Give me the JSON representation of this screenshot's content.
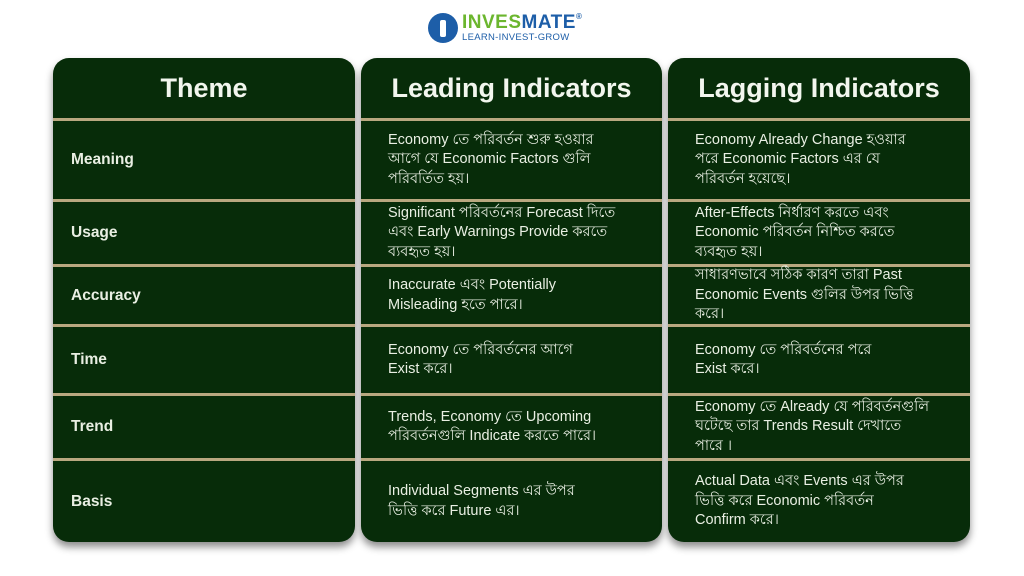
{
  "brand": {
    "name_part1": "INVES",
    "name_part2": "MATE",
    "registered": "®",
    "tagline": "LEARN-INVEST-GROW",
    "colors": {
      "green": "#6bb62e",
      "blue": "#1d5ea8"
    }
  },
  "table": {
    "headers": [
      "Theme",
      "Leading Indicators",
      "Lagging Indicators"
    ],
    "rows": [
      {
        "theme": "Meaning",
        "leading": "Economy তে পরিবর্তন শুরু হওয়ার\nআগে যে Economic Factors গুলি\nপরিবর্তিত হয়।",
        "lagging": "Economy Already Change হওয়ার\nপরে Economic Factors এর যে\nপরিবর্তন হয়েছে।"
      },
      {
        "theme": "Usage",
        "leading": "Significant পরিবর্তনের Forecast দিতে\nএবং Early Warnings Provide করতে\nব্যবহৃত হয়।",
        "lagging": "After-Effects নির্ধারণ করতে এবং\nEconomic পরিবর্তন নিশ্চিত করতে\nব্যবহৃত হয়।"
      },
      {
        "theme": "Accuracy",
        "leading": "Inaccurate এবং Potentially\nMisleading হতে পারে।",
        "lagging": "সাধারণভাবে সঠিক কারণ তারা Past\nEconomic Events গুলির উপর ভিত্তি\nকরে।"
      },
      {
        "theme": "Time",
        "leading": "Economy তে পরিবর্তনের আগে\nExist করে।",
        "lagging": "Economy তে পরিবর্তনের পরে\nExist করে।"
      },
      {
        "theme": "Trend",
        "leading": "Trends, Economy তে Upcoming\nপরিবর্তনগুলি Indicate করতে পারে।",
        "lagging": "Economy তে Already যে পরিবর্তনগুলি\nঘটেছে তার Trends Result দেখাতে\nপারে ।"
      },
      {
        "theme": "Basis",
        "leading": "Individual Segments এর উপর\nভিত্তি করে Future এর।",
        "lagging": "Actual Data এবং Events এর উপর\nভিত্তি করে Economic পরিবর্তন\nConfirm করে।"
      }
    ]
  },
  "colors": {
    "panel": "#072c09",
    "divider": "#b9a880",
    "text": "#e9efe3"
  }
}
